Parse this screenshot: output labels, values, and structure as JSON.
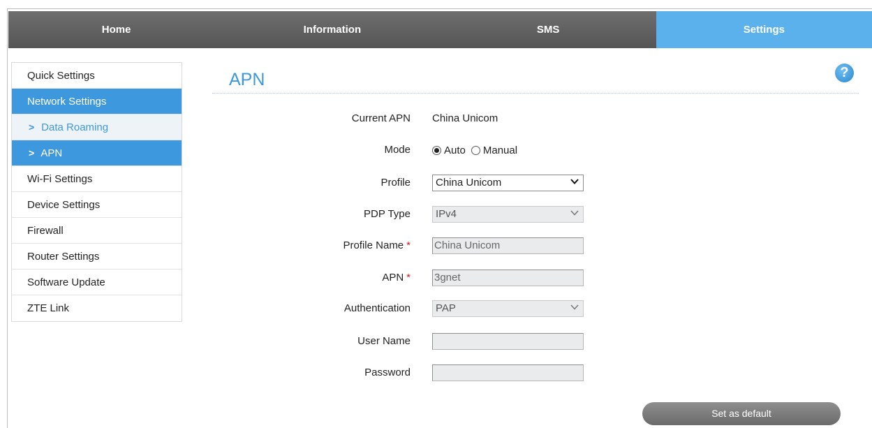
{
  "nav": {
    "tabs": [
      {
        "label": "Home"
      },
      {
        "label": "Information"
      },
      {
        "label": "SMS"
      },
      {
        "label": "Settings"
      }
    ],
    "active_tab": "Settings",
    "active_color": "#5bb1ec"
  },
  "sidebar": {
    "items": [
      {
        "label": "Quick Settings"
      },
      {
        "label": "Network Settings"
      },
      {
        "label": "Data Roaming"
      },
      {
        "label": "APN"
      },
      {
        "label": "Wi-Fi Settings"
      },
      {
        "label": "Device Settings"
      },
      {
        "label": "Firewall"
      },
      {
        "label": "Router Settings"
      },
      {
        "label": "Software Update"
      },
      {
        "label": "ZTE Link"
      }
    ],
    "chevron": ">",
    "accent_color": "#3d98dd"
  },
  "page": {
    "title": "APN",
    "help_icon": "?"
  },
  "form": {
    "current_apn": {
      "label": "Current APN",
      "value": "China Unicom"
    },
    "mode": {
      "label": "Mode",
      "options": [
        "Auto",
        "Manual"
      ],
      "selected": "Auto"
    },
    "profile": {
      "label": "Profile",
      "value": "China Unicom"
    },
    "pdp_type": {
      "label": "PDP Type",
      "value": "IPv4"
    },
    "profile_name": {
      "label": "Profile Name",
      "required_mark": "*",
      "value": "China Unicom"
    },
    "apn": {
      "label": "APN",
      "required_mark": "*",
      "value": "3gnet"
    },
    "authentication": {
      "label": "Authentication",
      "value": "PAP"
    },
    "user_name": {
      "label": "User Name",
      "value": ""
    },
    "password": {
      "label": "Password",
      "value": ""
    }
  },
  "actions": {
    "set_default_label": "Set as default"
  }
}
